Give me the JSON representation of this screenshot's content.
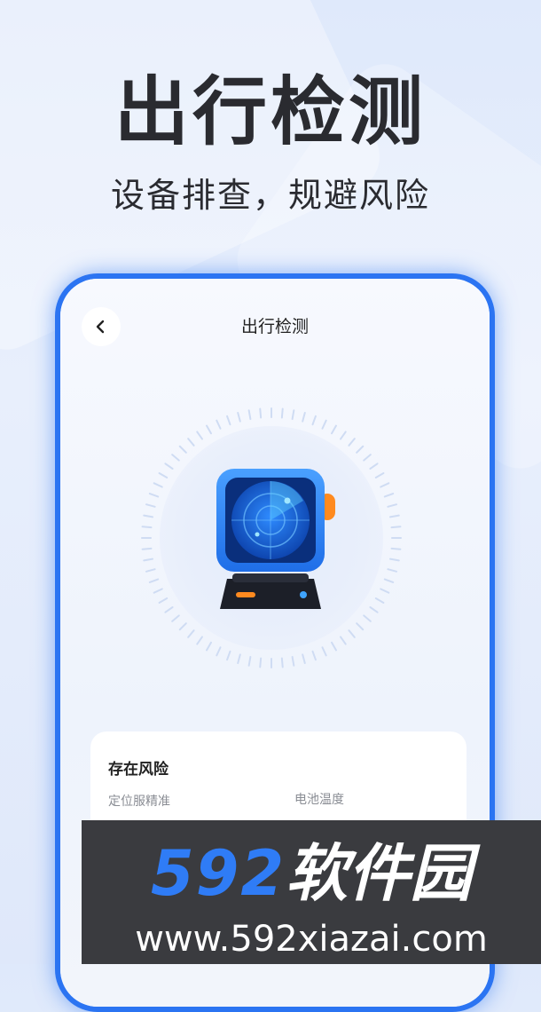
{
  "hero": {
    "title": "出行检测",
    "subtitle": "设备排查，规避风险"
  },
  "screen": {
    "title": "出行检测",
    "back_icon": "chevron-left-icon"
  },
  "radar": {
    "icon": "radar-device-icon",
    "accent": "#2b74f2",
    "knob_color": "#ff8a1f"
  },
  "risk_card": {
    "title": "存在风险",
    "items": [
      "定位服精准",
      "电池温度"
    ]
  },
  "watermark": {
    "brand_number": "592",
    "brand_text": "软件园",
    "url": "www.592xiazai.com"
  }
}
